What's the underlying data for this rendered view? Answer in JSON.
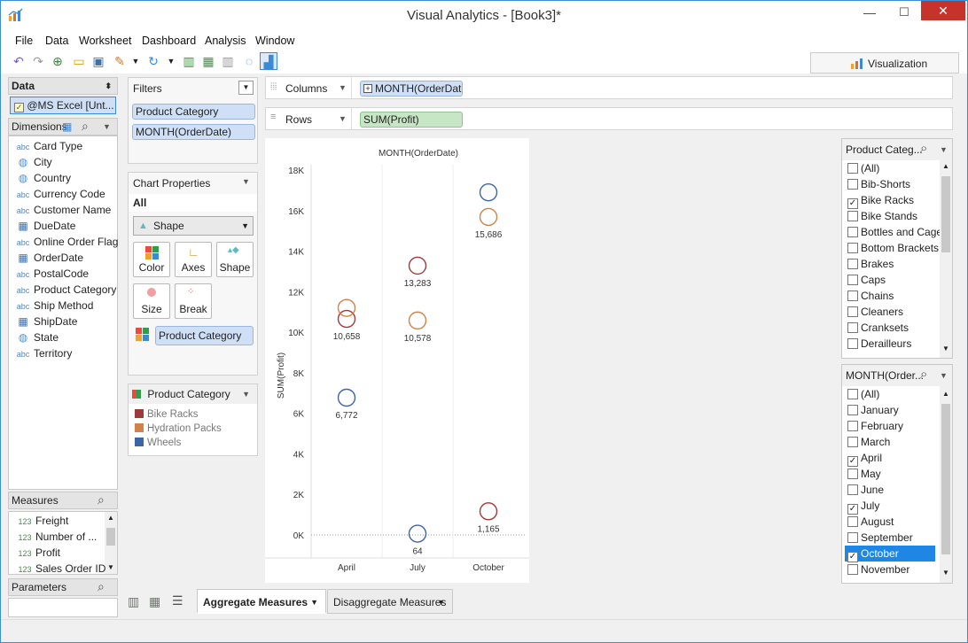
{
  "window": {
    "title": "Visual Analytics - [Book3]*",
    "minimize": "—",
    "maximize": "☐",
    "close": "✕"
  },
  "menu": [
    "File",
    "Data",
    "Worksheet",
    "Dashboard",
    "Analysis",
    "Window"
  ],
  "toolbar": {
    "visualization_label": "Visualization"
  },
  "data_panel": {
    "header": "Data",
    "source": "@MS Excel [Unt...",
    "dimensions_header": "Dimensions",
    "dimensions": [
      {
        "type": "abc",
        "name": "Card Type"
      },
      {
        "type": "geo",
        "name": "City"
      },
      {
        "type": "geo",
        "name": "Country"
      },
      {
        "type": "abc",
        "name": "Currency Code"
      },
      {
        "type": "abc",
        "name": "Customer Name"
      },
      {
        "type": "date",
        "name": "DueDate"
      },
      {
        "type": "abc",
        "name": "Online Order Flag"
      },
      {
        "type": "date",
        "name": "OrderDate"
      },
      {
        "type": "abc",
        "name": "PostalCode"
      },
      {
        "type": "abc",
        "name": "Product Category"
      },
      {
        "type": "abc",
        "name": "Ship Method"
      },
      {
        "type": "date",
        "name": "ShipDate"
      },
      {
        "type": "geo",
        "name": "State"
      },
      {
        "type": "abc",
        "name": "Territory"
      }
    ],
    "measures_header": "Measures",
    "measures": [
      {
        "type": "123",
        "name": "Freight"
      },
      {
        "type": "123",
        "name": "Number of ..."
      },
      {
        "type": "123",
        "name": "Profit"
      },
      {
        "type": "123",
        "name": "Sales Order ID"
      }
    ],
    "parameters_header": "Parameters"
  },
  "filters": {
    "header": "Filters",
    "items": [
      "Product Category",
      "MONTH(OrderDate)"
    ]
  },
  "chart_properties": {
    "header": "Chart Properties",
    "scope": "All",
    "mark_type": "Shape",
    "buttons": [
      "Color",
      "Axes",
      "Shape",
      "Size",
      "Break"
    ],
    "color_field": "Product Category"
  },
  "legend": {
    "header": "Product Category",
    "items": [
      {
        "name": "Bike Racks",
        "color": "#9e3a3a"
      },
      {
        "name": "Hydration Packs",
        "color": "#d0824a"
      },
      {
        "name": "Wheels",
        "color": "#3e64a8"
      }
    ]
  },
  "shelves": {
    "columns_label": "Columns",
    "columns_field": "MONTH(OrderDate)",
    "rows_label": "Rows",
    "rows_field": "SUM(Profit)"
  },
  "chart_data": {
    "type": "scatter",
    "title": "MONTH(OrderDate)",
    "xlabel": "",
    "ylabel": "SUM(Profit)",
    "categories": [
      "April",
      "July",
      "October"
    ],
    "ylim": [
      0,
      18000
    ],
    "yticks": [
      "0K",
      "2K",
      "4K",
      "6K",
      "8K",
      "10K",
      "12K",
      "14K",
      "16K",
      "18K"
    ],
    "series": [
      {
        "name": "Bike Racks",
        "color": "#9e3a3a",
        "values": [
          10658,
          13283,
          1165
        ],
        "labels": [
          "10,658",
          "13,283",
          "1,165"
        ]
      },
      {
        "name": "Hydration Packs",
        "color": "#d0824a",
        "values": [
          11200,
          10578,
          15686
        ],
        "labels": [
          "",
          "10,578",
          "15,686"
        ]
      },
      {
        "name": "Wheels",
        "color": "#3e64a8",
        "values": [
          6772,
          64,
          16900
        ],
        "labels": [
          "6,772",
          "64",
          ""
        ]
      }
    ]
  },
  "category_filter": {
    "header": "Product Categ...",
    "items": [
      {
        "label": "(All)",
        "checked": false
      },
      {
        "label": "Bib-Shorts",
        "checked": false
      },
      {
        "label": "Bike Racks",
        "checked": true
      },
      {
        "label": "Bike Stands",
        "checked": false
      },
      {
        "label": "Bottles and Cages",
        "checked": false
      },
      {
        "label": "Bottom Brackets",
        "checked": false
      },
      {
        "label": "Brakes",
        "checked": false
      },
      {
        "label": "Caps",
        "checked": false
      },
      {
        "label": "Chains",
        "checked": false
      },
      {
        "label": "Cleaners",
        "checked": false
      },
      {
        "label": "Cranksets",
        "checked": false
      },
      {
        "label": "Derailleurs",
        "checked": false
      }
    ]
  },
  "month_filter": {
    "header": "MONTH(Order...",
    "items": [
      {
        "label": "(All)",
        "checked": false
      },
      {
        "label": "January",
        "checked": false
      },
      {
        "label": "February",
        "checked": false
      },
      {
        "label": "March",
        "checked": false
      },
      {
        "label": "April",
        "checked": true
      },
      {
        "label": "May",
        "checked": false
      },
      {
        "label": "June",
        "checked": false
      },
      {
        "label": "July",
        "checked": true
      },
      {
        "label": "August",
        "checked": false
      },
      {
        "label": "September",
        "checked": false
      },
      {
        "label": "October",
        "checked": true,
        "selected": true
      },
      {
        "label": "November",
        "checked": false
      }
    ]
  },
  "tabs": [
    {
      "label": "Aggregate Measures",
      "active": true
    },
    {
      "label": "Disaggregate Measures",
      "active": false
    }
  ]
}
